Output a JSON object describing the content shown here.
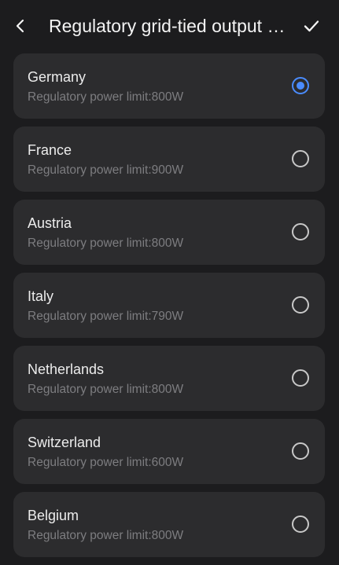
{
  "header": {
    "title": "Regulatory grid-tied output power",
    "back_icon": "chevron-left-icon",
    "confirm_icon": "check-icon"
  },
  "colors": {
    "background": "#1c1c1e",
    "card": "#2c2c2e",
    "accent": "#4a8cff"
  },
  "countries": [
    {
      "name": "Germany",
      "limit": "Regulatory power limit:800W",
      "selected": true
    },
    {
      "name": "France",
      "limit": "Regulatory power limit:900W",
      "selected": false
    },
    {
      "name": "Austria",
      "limit": "Regulatory power limit:800W",
      "selected": false
    },
    {
      "name": "Italy",
      "limit": "Regulatory power limit:790W",
      "selected": false
    },
    {
      "name": "Netherlands",
      "limit": "Regulatory power limit:800W",
      "selected": false
    },
    {
      "name": "Switzerland",
      "limit": "Regulatory power limit:600W",
      "selected": false
    },
    {
      "name": "Belgium",
      "limit": "Regulatory power limit:800W",
      "selected": false
    }
  ]
}
